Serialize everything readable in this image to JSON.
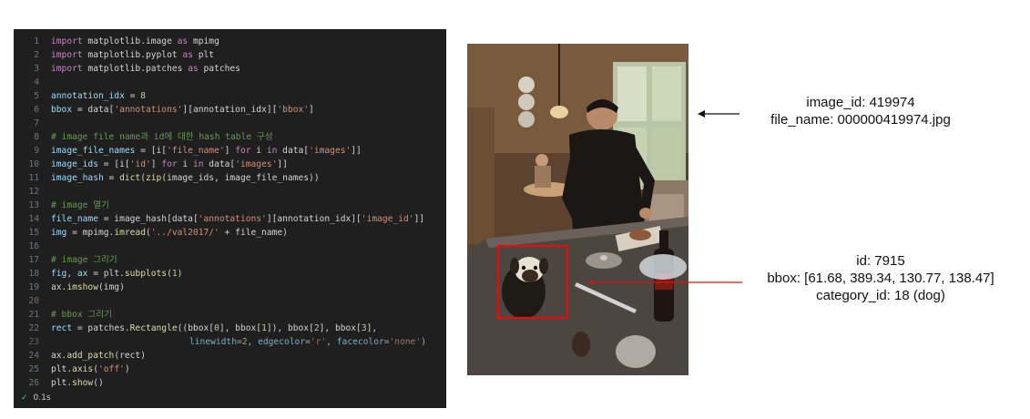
{
  "code": {
    "lines": [
      "1",
      "2",
      "3",
      "4",
      "5",
      "6",
      "7",
      "8",
      "9",
      "10",
      "11",
      "12",
      "13",
      "14",
      "15",
      "16",
      "17",
      "18",
      "19",
      "20",
      "21",
      "22",
      "23",
      "24",
      "25",
      "26"
    ],
    "tokens": {
      "l1": [
        "import",
        " matplotlib.image ",
        "as",
        " mpimg"
      ],
      "l2": [
        "import",
        " matplotlib.pyplot ",
        "as",
        " plt"
      ],
      "l3": [
        "import",
        " matplotlib.patches ",
        "as",
        " patches"
      ],
      "l5": [
        "annotation_idx",
        " = ",
        "8"
      ],
      "l6": [
        "bbox",
        " = data[",
        "'annotations'",
        "][annotation_idx][",
        "'bbox'",
        "]"
      ],
      "l8": "# image file name과 id에 대한 hash table 구성",
      "l9": [
        "image_file_names",
        " = [i[",
        "'file_name'",
        "] ",
        "for",
        " i ",
        "in",
        " data[",
        "'images'",
        "]]"
      ],
      "l10": [
        "image_ids",
        " = [i[",
        "'id'",
        "] ",
        "for",
        " i ",
        "in",
        " data[",
        "'images'",
        "]]"
      ],
      "l11": [
        "image_hash",
        " = ",
        "dict",
        "(",
        "zip",
        "(image_ids, image_file_names))"
      ],
      "l13": "# image 열기",
      "l14": [
        "file_name",
        " = image_hash[data[",
        "'annotations'",
        "][annotation_idx][",
        "'image_id'",
        "]]"
      ],
      "l15": [
        "img",
        " = mpimg.",
        "imread",
        "(",
        "'../val2017/'",
        " + file_name)"
      ],
      "l17": "# image 그리기",
      "l18": [
        "fig, ax",
        " = plt.",
        "subplots",
        "(",
        "1",
        ")"
      ],
      "l19": [
        "ax.",
        "imshow",
        "(img)"
      ],
      "l21": "# bbox 그리기",
      "l22": [
        "rect",
        " = patches.",
        "Rectangle",
        "((bbox[",
        "0",
        "], bbox[",
        "1",
        "]), bbox[",
        "2",
        "], bbox[",
        "3",
        "],"
      ],
      "l23": [
        "linewidth",
        "=",
        "2",
        ", ",
        "edgecolor",
        "=",
        "'r'",
        ", ",
        "facecolor",
        "=",
        "'none'",
        ")"
      ],
      "l24": [
        "ax.",
        "add_patch",
        "(rect)"
      ],
      "l25": [
        "plt.",
        "axis",
        "(",
        "'off'",
        ")"
      ],
      "l26": [
        "plt.",
        "show",
        "()"
      ]
    },
    "status_time": "0.1s"
  },
  "image_info": {
    "image_id": "image_id: 419974",
    "file_name": "file_name: 000000419974.jpg"
  },
  "annotation_info": {
    "id": "id: 7915",
    "bbox": "bbox: [61.68, 389.34, 130.77, 138.47]",
    "category_id": "category_id: 18  (dog)"
  },
  "colors": {
    "bbox_edge": "#e01010",
    "pointer_arrow": "#111111",
    "annotation_line": "#e01010"
  }
}
